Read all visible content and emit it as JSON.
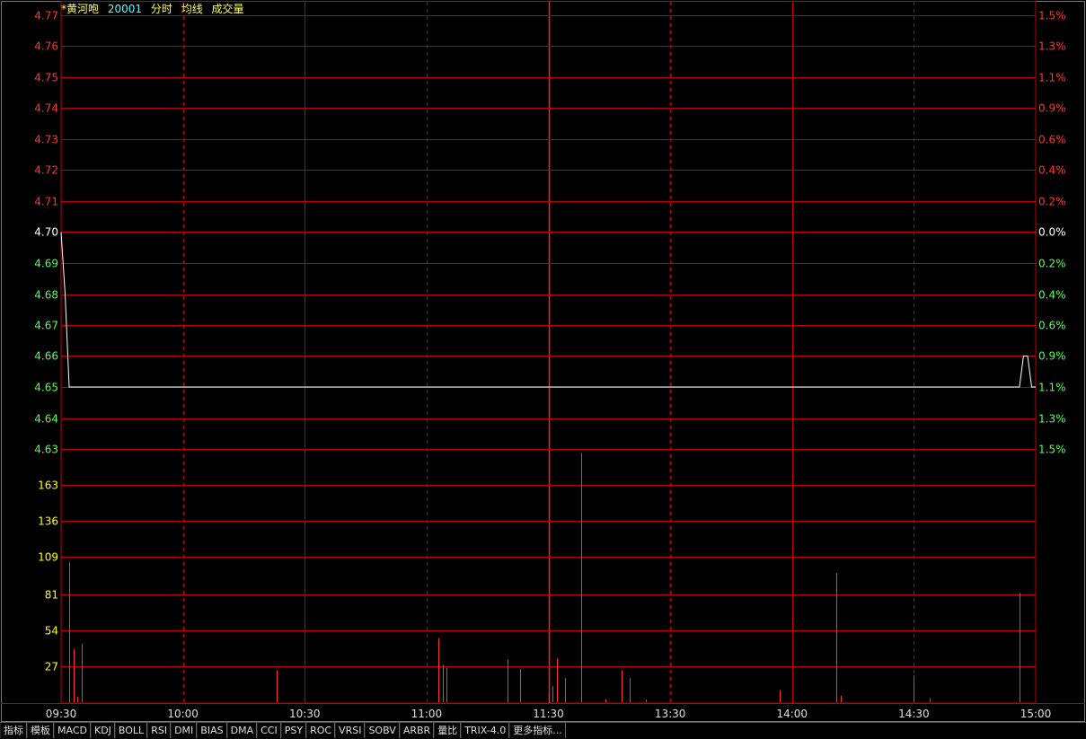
{
  "header": {
    "stock_name": "*黄河咆",
    "stock_code": "20001",
    "labels": [
      "分时",
      "均线",
      "成交量"
    ]
  },
  "colors": {
    "up": "#ff3232",
    "down": "#54fc54",
    "flat": "#ffffff",
    "grid": "#c00000",
    "volume_label": "#ffff00",
    "title_name": "#ffff54",
    "title_code": "#54fcfc",
    "title_labels": "#ffff54",
    "price_line": "#ffffff",
    "volume_bar": "#ff3232"
  },
  "toolbar": {
    "items": [
      "指标",
      "模板",
      "MACD",
      "KDJ",
      "BOLL",
      "RSI",
      "DMI",
      "BIAS",
      "DMA",
      "CCI",
      "PSY",
      "ROC",
      "VRSI",
      "SOBV",
      "ARBR",
      "量比",
      "TRIX-4.0",
      "更多指标..."
    ]
  },
  "chart_data": [
    {
      "type": "line",
      "panel": "price",
      "x_tick_labels": [
        "09:30",
        "10:00",
        "10:30",
        "11:00",
        "11:30",
        "13:30",
        "14:00",
        "14:30",
        "15:00"
      ],
      "total_minutes": 240,
      "prev_close": 4.7,
      "ylim": [
        4.63,
        4.77
      ],
      "price_tick_labels": [
        "4.77",
        "4.76",
        "4.75",
        "4.74",
        "4.73",
        "4.72",
        "4.71",
        "4.70",
        "4.69",
        "4.68",
        "4.67",
        "4.66",
        "4.65",
        "4.64",
        "4.63"
      ],
      "pct_tick_labels": [
        "1.5%",
        "1.3%",
        "1.1%",
        "0.9%",
        "0.6%",
        "0.4%",
        "0.2%",
        "0.0%",
        "0.2%",
        "0.4%",
        "0.6%",
        "0.9%",
        "1.1%",
        "1.3%",
        "1.5%"
      ],
      "series": [
        {
          "points": [
            [
              0,
              4.7
            ],
            [
              1,
              4.68
            ],
            [
              2,
              4.65
            ],
            [
              236,
              4.65
            ],
            [
              237,
              4.66
            ],
            [
              238,
              4.66
            ],
            [
              239,
              4.65
            ],
            [
              240,
              4.65
            ]
          ]
        }
      ]
    },
    {
      "type": "bar",
      "panel": "volume",
      "ylim": [
        0,
        190
      ],
      "y_tick_labels": [
        "163",
        "136",
        "109",
        "81",
        "54",
        "27"
      ],
      "y_tick_values": [
        163,
        136,
        109,
        81,
        54,
        27
      ],
      "bars": [
        [
          2,
          105
        ],
        [
          3,
          40
        ],
        [
          4,
          4
        ],
        [
          5,
          44
        ],
        [
          53,
          24
        ],
        [
          93,
          48
        ],
        [
          94,
          28
        ],
        [
          95,
          26
        ],
        [
          110,
          32
        ],
        [
          113,
          25
        ],
        [
          120,
          6
        ],
        [
          121,
          12
        ],
        [
          122,
          33
        ],
        [
          124,
          18
        ],
        [
          128,
          187
        ],
        [
          134,
          2
        ],
        [
          138,
          24
        ],
        [
          140,
          18
        ],
        [
          144,
          2
        ],
        [
          177,
          9
        ],
        [
          191,
          97
        ],
        [
          192,
          5
        ],
        [
          210,
          20
        ],
        [
          214,
          3
        ],
        [
          236,
          82
        ]
      ]
    }
  ]
}
